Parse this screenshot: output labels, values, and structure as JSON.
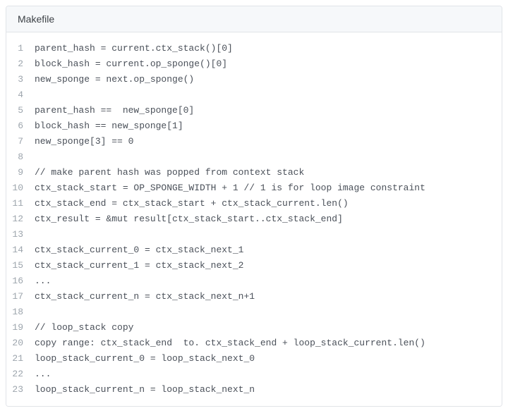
{
  "header": {
    "language": "Makefile"
  },
  "code": {
    "lines": [
      {
        "num": "1",
        "text": "parent_hash = current.ctx_stack()[0]"
      },
      {
        "num": "2",
        "text": "block_hash = current.op_sponge()[0]"
      },
      {
        "num": "3",
        "text": "new_sponge = next.op_sponge()"
      },
      {
        "num": "4",
        "text": ""
      },
      {
        "num": "5",
        "text": "parent_hash ==  new_sponge[0]"
      },
      {
        "num": "6",
        "text": "block_hash == new_sponge[1]"
      },
      {
        "num": "7",
        "text": "new_sponge[3] == 0"
      },
      {
        "num": "8",
        "text": ""
      },
      {
        "num": "9",
        "text": "// make parent hash was popped from context stack"
      },
      {
        "num": "10",
        "text": "ctx_stack_start = OP_SPONGE_WIDTH + 1 // 1 is for loop image constraint"
      },
      {
        "num": "11",
        "text": "ctx_stack_end = ctx_stack_start + ctx_stack_current.len()"
      },
      {
        "num": "12",
        "text": "ctx_result = &mut result[ctx_stack_start..ctx_stack_end]"
      },
      {
        "num": "13",
        "text": ""
      },
      {
        "num": "14",
        "text": "ctx_stack_current_0 = ctx_stack_next_1"
      },
      {
        "num": "15",
        "text": "ctx_stack_current_1 = ctx_stack_next_2"
      },
      {
        "num": "16",
        "text": "..."
      },
      {
        "num": "17",
        "text": "ctx_stack_current_n = ctx_stack_next_n+1"
      },
      {
        "num": "18",
        "text": ""
      },
      {
        "num": "19",
        "text": "// loop_stack copy"
      },
      {
        "num": "20",
        "text": "copy range: ctx_stack_end  to. ctx_stack_end + loop_stack_current.len()"
      },
      {
        "num": "21",
        "text": "loop_stack_current_0 = loop_stack_next_0"
      },
      {
        "num": "22",
        "text": "..."
      },
      {
        "num": "23",
        "text": "loop_stack_current_n = loop_stack_next_n"
      }
    ]
  }
}
